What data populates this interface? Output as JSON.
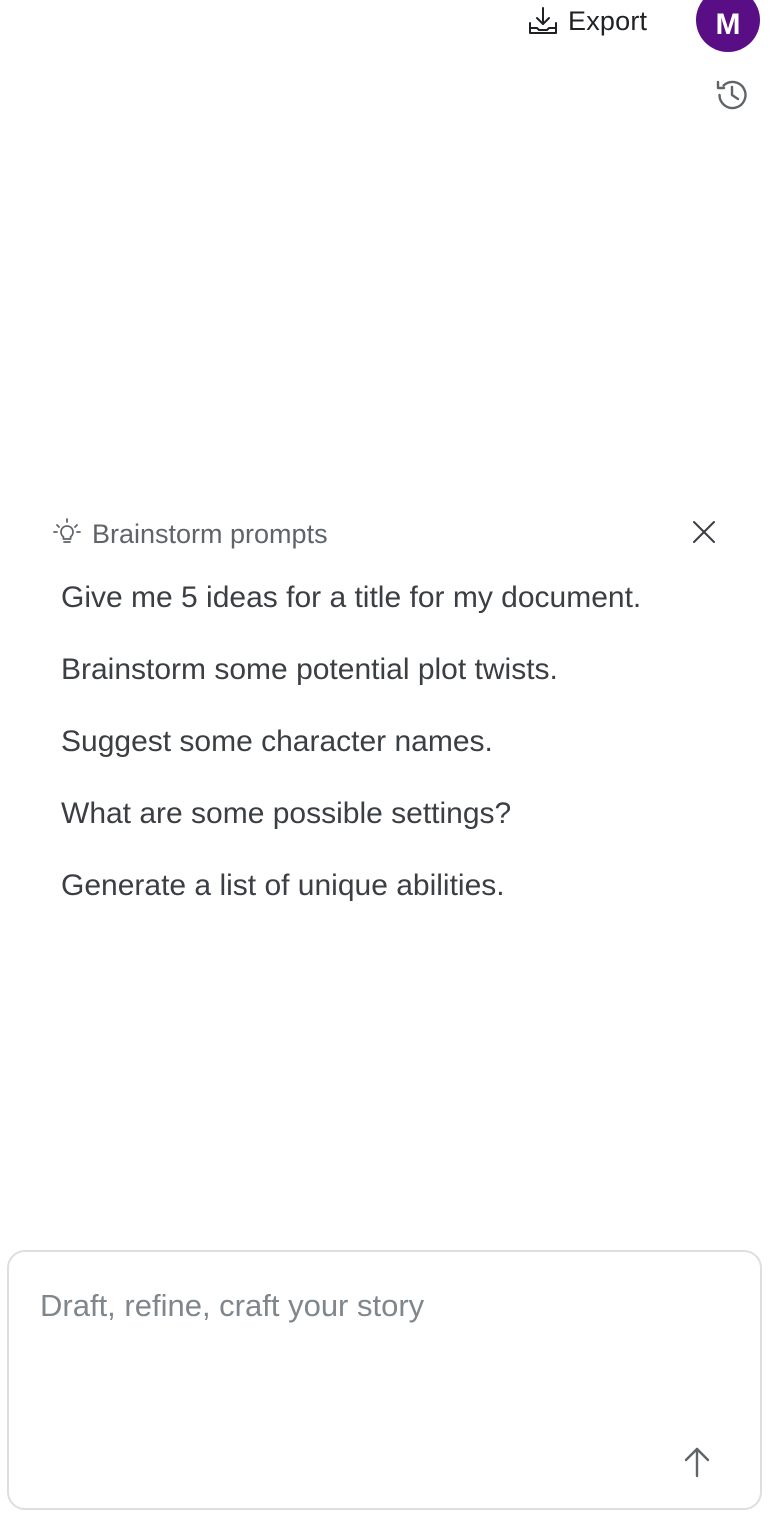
{
  "header": {
    "export_label": "Export",
    "avatar_initial": "M",
    "avatar_color": "#5a0e86",
    "export_icon": "download-tray-icon",
    "history_icon": "history-clock-icon"
  },
  "brainstorm": {
    "title": "Brainstorm prompts",
    "title_icon": "lightbulb-icon",
    "close_icon": "close-icon",
    "prompts": [
      "Give me 5 ideas for a title for my document.",
      "Brainstorm some potential plot twists.",
      "Suggest some character names.",
      "What are some possible settings?",
      "Generate a list of unique abilities."
    ]
  },
  "composer": {
    "placeholder": "Draft, refine, craft your story",
    "value": "",
    "send_icon": "arrow-up-icon"
  }
}
